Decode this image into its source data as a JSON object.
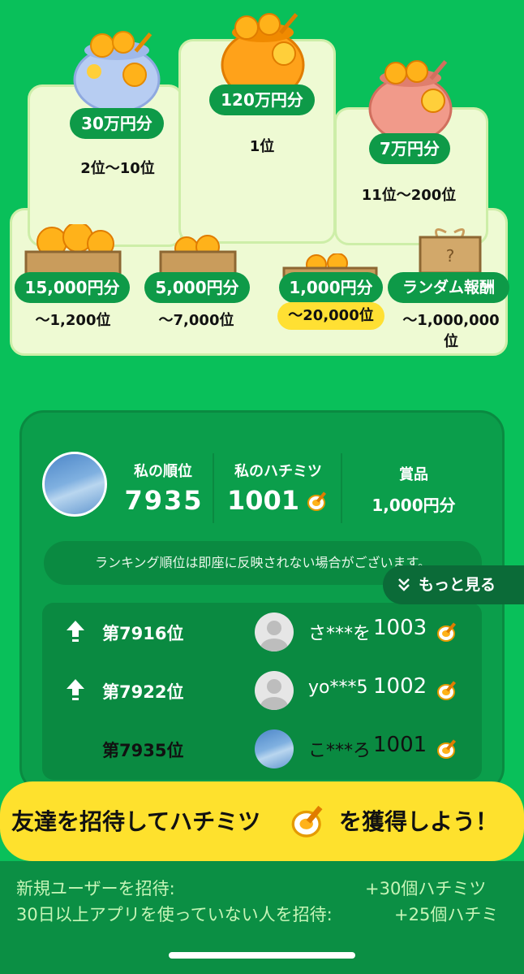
{
  "prizes": {
    "top": [
      {
        "amount": "30万円分",
        "rank": "2位〜10位"
      },
      {
        "amount": "120万円分",
        "rank": "1位"
      },
      {
        "amount": "7万円分",
        "rank": "11位〜200位"
      }
    ],
    "bottom": [
      {
        "amount": "15,000円分",
        "rank": "〜1,200位"
      },
      {
        "amount": "5,000円分",
        "rank": "〜7,000位"
      },
      {
        "amount": "1,000円分",
        "rank": "〜20,000位"
      },
      {
        "amount": "ランダム報酬",
        "rank_line1": "〜1,000,000",
        "rank_line2": "位"
      }
    ]
  },
  "my": {
    "rank_label": "私の順位",
    "rank_value": "7935",
    "honey_label": "私のハチミツ",
    "honey_value": "1001",
    "prize_label": "賞品",
    "prize_value": "1,000円分"
  },
  "notice": "ランキング順位は即座に反映されない場合がございます。",
  "more_label": "もっと見る",
  "leaderboard": [
    {
      "rank": "第7916位",
      "name": "さ***を",
      "honey": "1003",
      "trend": "up"
    },
    {
      "rank": "第7922位",
      "name": "yo***5",
      "honey": "1002",
      "trend": "up"
    },
    {
      "rank": "第7935位",
      "name": "こ***ろ",
      "honey": "1001",
      "trend": "none"
    }
  ],
  "banner": {
    "left": "友達を招待してハチミツ",
    "right": "を獲得しよう！"
  },
  "rewards": [
    {
      "label": "新規ユーザーを招待:",
      "value": "+30個ハチミツ"
    },
    {
      "label": "30日以上アプリを使っていない人を招待:",
      "value": "+25個ハチミ"
    }
  ],
  "colors": {
    "background": "#09c05a",
    "pill": "#0e9a48",
    "highlight": "#ffe033",
    "banner": "#fee12d"
  }
}
